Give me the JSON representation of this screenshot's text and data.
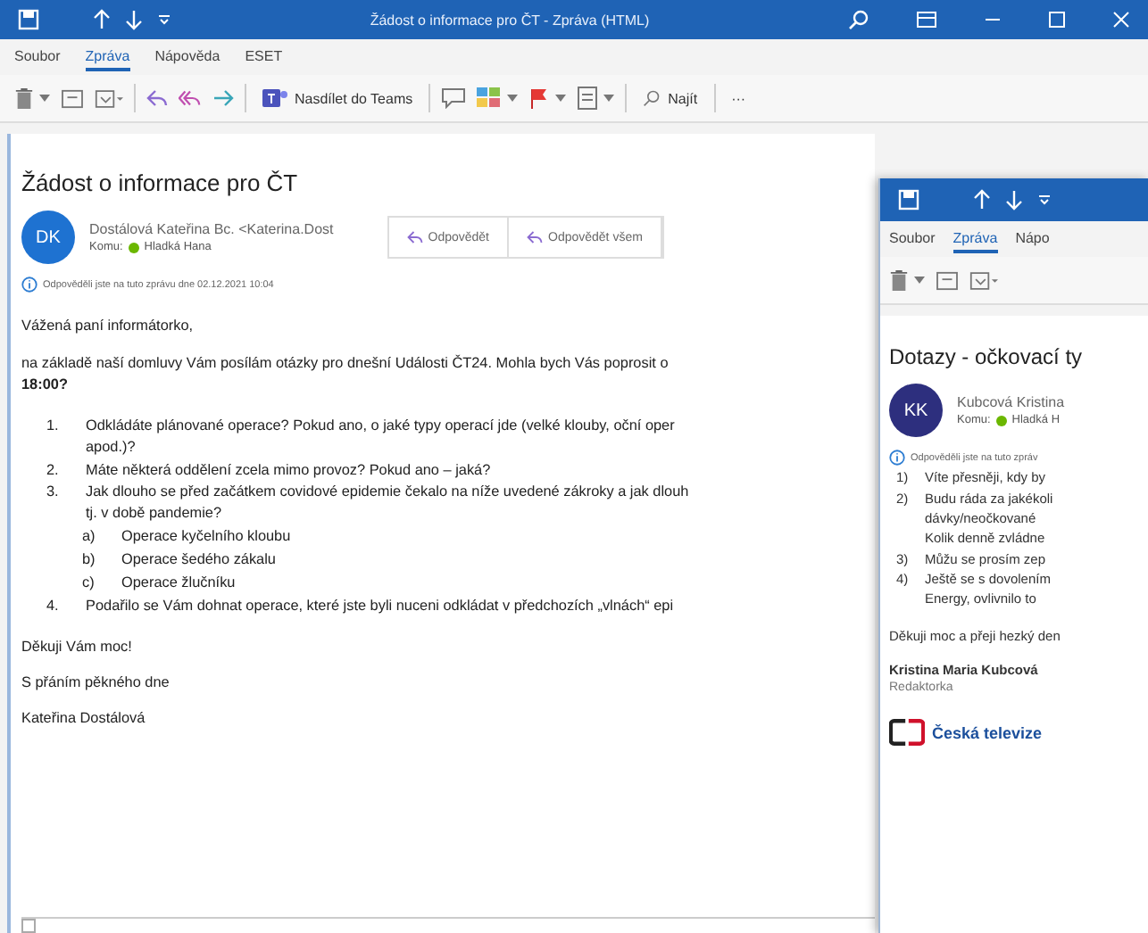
{
  "main_window": {
    "title": "Žádost o informace pro ČT  -  Zpráva (HTML)",
    "tabs": [
      {
        "label": "Soubor",
        "selected": false
      },
      {
        "label": "Zpráva",
        "selected": true
      },
      {
        "label": "Nápověda",
        "selected": false
      },
      {
        "label": "ESET",
        "selected": false
      }
    ],
    "toolbar": {
      "teams_label": "Nasdílet do Teams",
      "find_label": "Najít",
      "more_label": "···"
    },
    "message": {
      "subject": "Žádost o informace pro ČT",
      "avatar_initials": "DK",
      "sender": "Dostálová Kateřina Bc. <Katerina.Dost",
      "to_label": "Komu:",
      "recipient": "Hladká Hana",
      "actions": [
        "Odpovědět",
        "Odpovědět všem"
      ],
      "info": "Odpověděli jste na tuto zprávu dne 02.12.2021 10:04",
      "greeting": "Vážená paní informátorko,",
      "intro": "na základě naší domluvy Vám posílám otázky pro dnešní Události ČT24. Mohla bych Vás poprosit o\n**18:00?**",
      "list": [
        {
          "number": "1.",
          "text": "Odkládáte plánované operace? Pokud ano, o jaké typy operací jde (velké klouby, oční oper\napod.)?"
        },
        {
          "number": "2.",
          "text": "Máte některá oddělení zcela mimo provoz? Pokud ano – jaká?"
        },
        {
          "number": "3.",
          "text": "Jak dlouho se před začátkem covidové epidemie čekalo na níže uvedené zákroky a jak dlouh\ntj. v době pandemie?",
          "children": [
            {
              "number": "a)",
              "text": "Operace kyčelního kloubu"
            },
            {
              "number": "b)",
              "text": "Operace šedého zákalu"
            },
            {
              "number": "c)",
              "text": "Operace žlučníku"
            }
          ]
        },
        {
          "number": "4.",
          "text": "Podařilo se Vám dohnat operace, které jste byli nuceni odkládat v předchozích „vlnách“ epi"
        }
      ],
      "closing": [
        "Děkuji Vám moc!",
        "S přáním pěkného dne"
      ],
      "signature": "Kateřina Dostálová"
    }
  },
  "second_window": {
    "tabs": [
      {
        "label": "Soubor",
        "selected": false
      },
      {
        "label": "Zpráva",
        "selected": true
      },
      {
        "label": "Nápo",
        "selected": false
      }
    ],
    "message": {
      "subject": "Dotazy - očkovací ty",
      "avatar_initials": "KK",
      "sender": "Kubcová Kristina",
      "to_label": "Komu:",
      "recipient": "Hladká H",
      "info": "Odpověděli jste na tuto zpráv",
      "list": [
        {
          "number": "1)",
          "text": "Víte přesněji, kdy by"
        },
        {
          "number": "2)",
          "text": "Budu ráda za jakékoli\ndávky/neočkované\nKolik denně zvládne"
        },
        {
          "number": "3)",
          "text": "Můžu se prosím zep"
        },
        {
          "number": "4)",
          "text": "Ještě se s dovolením\nEnergy, ovlivnilo to"
        }
      ],
      "closing": "Děkuji moc a přeji hezký den",
      "signature_name": "Kristina Maria Kubcová",
      "signature_role": "Redaktorka",
      "logo_text": "Česká televize"
    }
  }
}
